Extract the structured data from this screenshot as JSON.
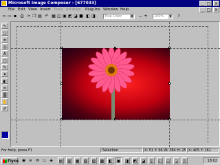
{
  "window": {
    "title": "Microsoft Image Composer - [677033]"
  },
  "menu": {
    "items": [
      {
        "label": "File",
        "enabled": true
      },
      {
        "label": "Edit",
        "enabled": true
      },
      {
        "label": "View",
        "enabled": true
      },
      {
        "label": "Insert",
        "enabled": true
      },
      {
        "label": "Tools",
        "enabled": false
      },
      {
        "label": "Arrange",
        "enabled": false
      },
      {
        "label": "Plug-Ins",
        "enabled": true
      },
      {
        "label": "Window",
        "enabled": true
      },
      {
        "label": "Help",
        "enabled": true
      }
    ]
  },
  "toolbar": {
    "color_combo": "True Color",
    "zoom_combo": "100%"
  },
  "statusbar": {
    "help": "For Help, press F1",
    "mode": "Selection",
    "coords": "X: 51 Y: 96 W: 384 H: 256",
    "cursor": "X: 405 Y: 161"
  },
  "taskbar": {
    "start_label": "Пуск",
    "clock": "18:02"
  },
  "colors": {
    "titlebar": "#000080",
    "current_color": "#0000a0"
  }
}
